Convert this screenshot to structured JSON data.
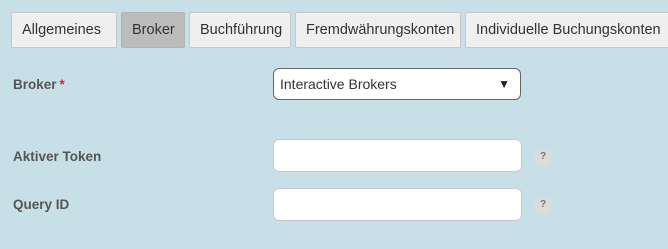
{
  "tabs": [
    {
      "label": "Allgemeines",
      "active": false
    },
    {
      "label": "Broker",
      "active": true
    },
    {
      "label": "Buchführung",
      "active": false
    },
    {
      "label": "Fremdwährungskonten",
      "active": false
    },
    {
      "label": "Individuelle Buchungskonten",
      "active": false
    }
  ],
  "form": {
    "broker": {
      "label": "Broker",
      "required_mark": "*",
      "selected_value": "Interactive Brokers",
      "arrow_glyph": "▼"
    },
    "active_token": {
      "label": "Aktiver Token",
      "value": "",
      "help_glyph": "?"
    },
    "query_id": {
      "label": "Query ID",
      "value": "",
      "help_glyph": "?"
    }
  },
  "colors": {
    "background": "#c7e0e7",
    "required": "#d9232d",
    "active_tab": "#bcbcbc"
  }
}
